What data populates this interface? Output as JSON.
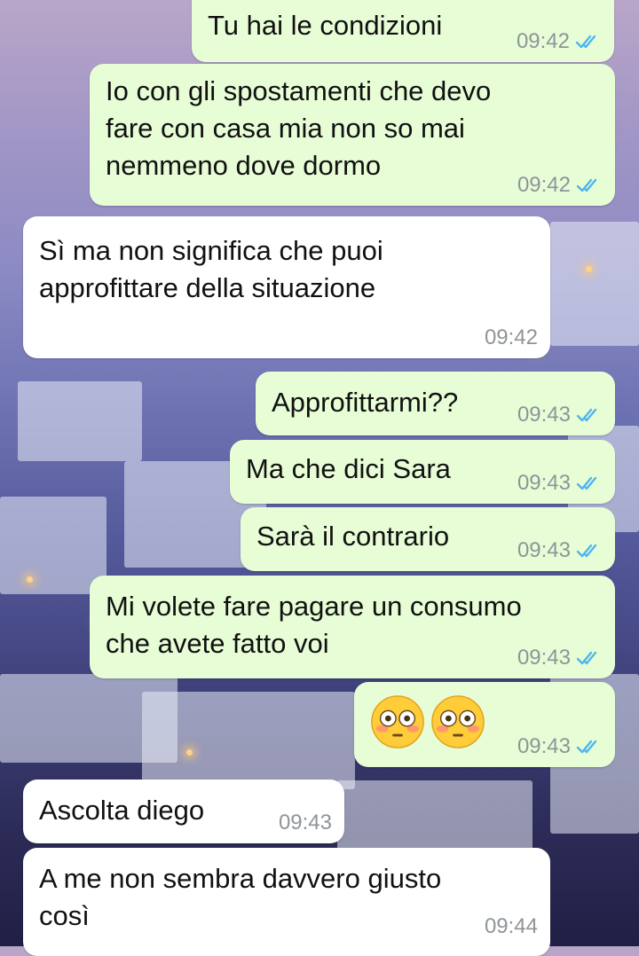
{
  "colors": {
    "outgoing_bubble": "#e7fdd6",
    "incoming_bubble": "#ffffff",
    "timestamp": "#8e9599",
    "read_ticks": "#4fb6ec"
  },
  "messages": [
    {
      "direction": "out",
      "text": "Tu hai le condizioni",
      "time": "09:42",
      "status": "read-ticks-icon"
    },
    {
      "direction": "out",
      "text": "Io con gli spostamenti che devo\nfare con casa mia non so mai\nnemmeno dove dormo",
      "time": "09:42",
      "status": "read-ticks-icon"
    },
    {
      "direction": "in",
      "text": "Sì ma non significa che puoi\napprofittare della situazione",
      "time": "09:42"
    },
    {
      "direction": "out",
      "text": "Approfittarmi??",
      "time": "09:43",
      "status": "read-ticks-icon"
    },
    {
      "direction": "out",
      "text": "Ma che dici Sara",
      "time": "09:43",
      "status": "read-ticks-icon"
    },
    {
      "direction": "out",
      "text": "Sarà il contrario",
      "time": "09:43",
      "status": "read-ticks-icon"
    },
    {
      "direction": "out",
      "text": "Mi volete fare pagare un consumo\nche avete fatto voi",
      "time": "09:43",
      "status": "read-ticks-icon"
    },
    {
      "direction": "out",
      "emoji": [
        "flushed-face-icon",
        "flushed-face-icon"
      ],
      "time": "09:43",
      "status": "read-ticks-icon"
    },
    {
      "direction": "in",
      "text": "Ascolta diego",
      "time": "09:43"
    },
    {
      "direction": "in",
      "text": "A me non sembra davvero giusto\ncosì",
      "time": "09:44"
    }
  ]
}
